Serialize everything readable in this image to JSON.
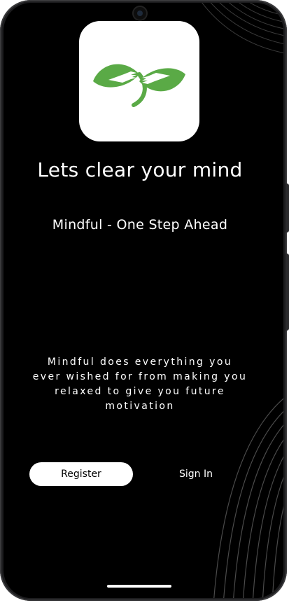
{
  "header": {
    "title": "Lets clear your mind",
    "subtitle": "Mindful - One Step Ahead"
  },
  "main": {
    "description": "Mindful does everything you ever wished for from making you relaxed to give you future motivation"
  },
  "actions": {
    "register_label": "Register",
    "signin_label": "Sign In"
  },
  "logo": {
    "icon": "leaf-hands-icon",
    "color": "#5aaa46"
  },
  "theme": {
    "background": "#000000",
    "text": "#ffffff",
    "button_background": "#ffffff"
  }
}
